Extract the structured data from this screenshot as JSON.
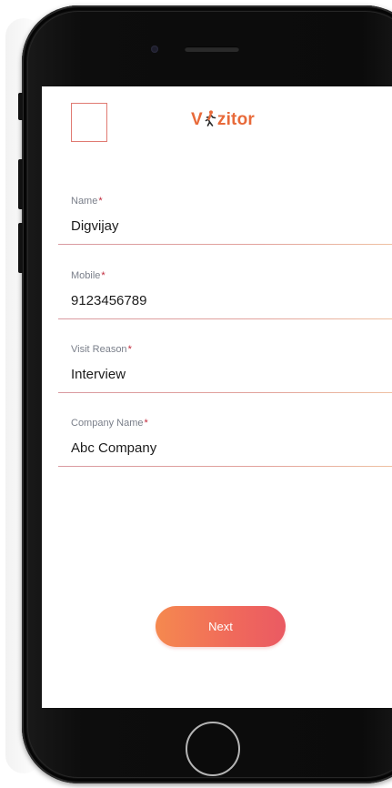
{
  "app": {
    "title_prefix": "V",
    "title_suffix": "zitor",
    "accent_color": "#e86a3a",
    "logo_icon": "person-walking-icon"
  },
  "form": {
    "fields": [
      {
        "label": "Name",
        "required_mark": "*",
        "value": "Digvijay"
      },
      {
        "label": "Mobile",
        "required_mark": "*",
        "value": "9123456789"
      },
      {
        "label": "Visit Reason",
        "required_mark": "*",
        "value": "Interview"
      },
      {
        "label": "Company Name",
        "required_mark": "*",
        "value": "Abc Company"
      }
    ],
    "next_label": "Next",
    "button_gradient": [
      "#f5894f",
      "#ea5a63"
    ]
  }
}
